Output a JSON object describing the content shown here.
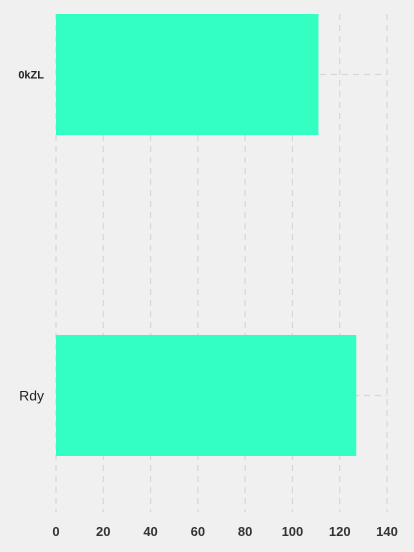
{
  "chart_data": {
    "type": "bar",
    "orientation": "horizontal",
    "title": "",
    "xlabel": "",
    "ylabel": "",
    "categories": [
      "0kZL",
      "Rdy"
    ],
    "category_label_bold": [
      true,
      false
    ],
    "series": [
      {
        "values": [
          111,
          127
        ]
      }
    ],
    "xlim": [
      0,
      140
    ],
    "x_ticks": [
      0,
      20,
      40,
      60,
      80,
      100,
      120,
      140
    ],
    "grid": true,
    "colors": {
      "bar": "#33ffc3",
      "grid": "#d6d6d6",
      "background": "#f0f0f0"
    }
  }
}
